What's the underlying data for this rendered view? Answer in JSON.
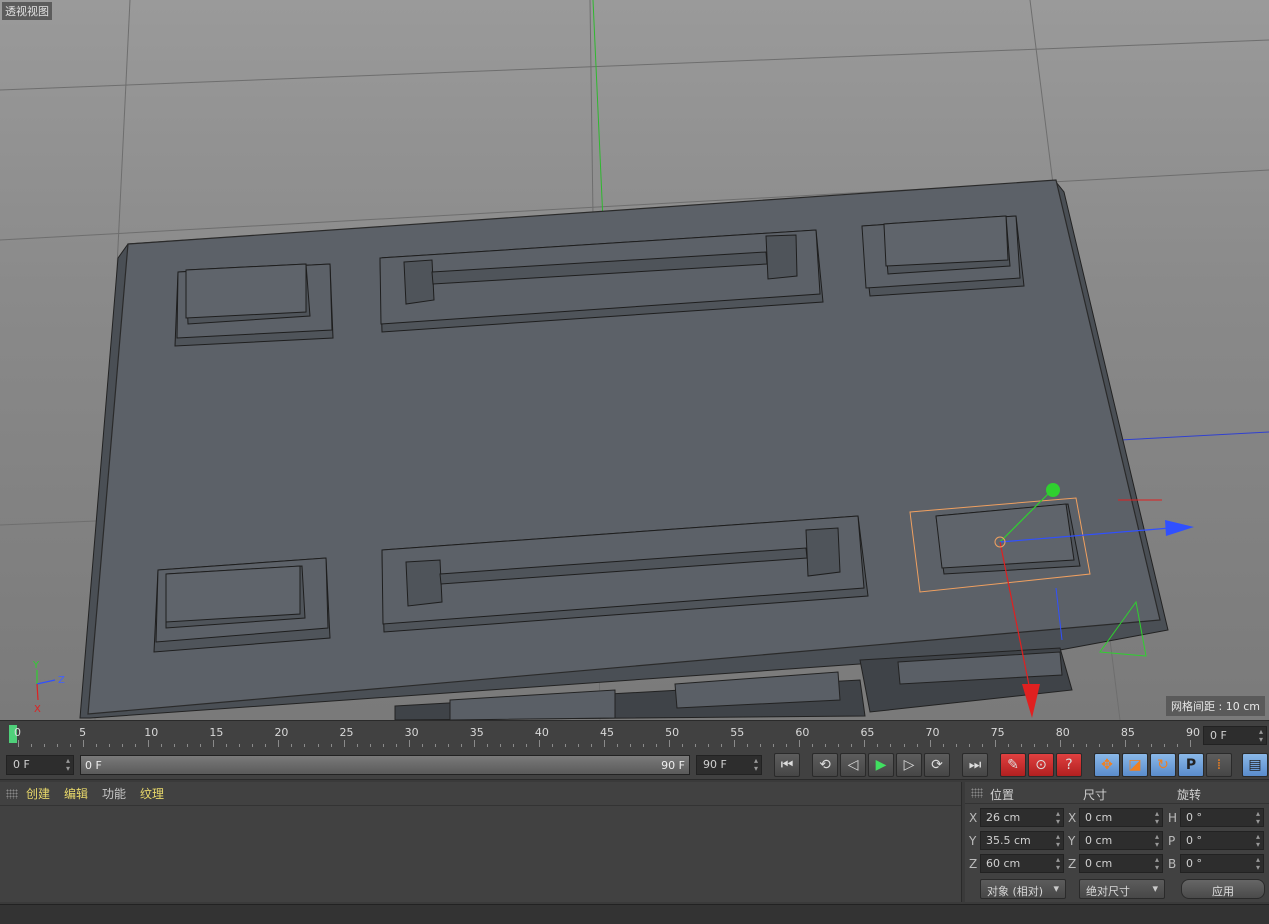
{
  "viewport": {
    "label": "透视视图",
    "grid_spacing": "网格间距 : 10 cm",
    "axis_labels": {
      "y": "Y",
      "z": "Z",
      "x": "X"
    }
  },
  "timeline": {
    "ticks": [
      "0",
      "5",
      "10",
      "15",
      "20",
      "25",
      "30",
      "35",
      "40",
      "45",
      "50",
      "55",
      "60",
      "65",
      "70",
      "75",
      "80",
      "85",
      "90"
    ],
    "current_frame_display": "0 F"
  },
  "transport": {
    "start_field": "0 F",
    "range_start": "0 F",
    "range_end": "90 F",
    "end_field": "90 F",
    "buttons": [
      {
        "name": "go-to-start-button",
        "glyph": "⏮"
      },
      {
        "name": "step-back-key-button",
        "glyph": "⟲"
      },
      {
        "name": "prev-frame-button",
        "glyph": "◁"
      },
      {
        "name": "play-button",
        "glyph": "▶"
      },
      {
        "name": "next-frame-button",
        "glyph": "▷"
      },
      {
        "name": "step-forward-key-button",
        "glyph": "⟳"
      },
      {
        "name": "go-to-end-button",
        "glyph": "⏭"
      }
    ],
    "record_buttons": [
      {
        "name": "record-key-button",
        "glyph": "✎"
      },
      {
        "name": "auto-key-button",
        "glyph": "⊙"
      },
      {
        "name": "key-help-button",
        "glyph": "?"
      }
    ],
    "key_mode_buttons": [
      {
        "name": "move-key-button",
        "glyph": "✥"
      },
      {
        "name": "scale-key-button",
        "glyph": "◪"
      },
      {
        "name": "rotate-key-button",
        "glyph": "↻"
      },
      {
        "name": "param-key-button",
        "glyph": "P"
      },
      {
        "name": "point-level-button",
        "glyph": "⁞"
      }
    ]
  },
  "materials_panel": {
    "menu": [
      "创建",
      "编辑",
      "功能",
      "纹理"
    ]
  },
  "coords_panel": {
    "headers": {
      "position": "位置",
      "size": "尺寸",
      "rotation": "旋转"
    },
    "rows": [
      {
        "pos_axis": "X",
        "pos": "26 cm",
        "size_axis": "X",
        "size": "0 cm",
        "rot_axis": "H",
        "rot": "0 °"
      },
      {
        "pos_axis": "Y",
        "pos": "35.5 cm",
        "size_axis": "Y",
        "size": "0 cm",
        "rot_axis": "P",
        "rot": "0 °"
      },
      {
        "pos_axis": "Z",
        "pos": "60 cm",
        "size_axis": "Z",
        "size": "0 cm",
        "rot_axis": "B",
        "rot": "0 °"
      }
    ],
    "mode_dropdown": "对象 (相对)",
    "size_dropdown": "绝对尺寸",
    "apply_label": "应用"
  },
  "colors": {
    "accent_green": "#4fd07a",
    "menu_yellow": "#e8d86a",
    "selection_orange": "#f0a060"
  }
}
